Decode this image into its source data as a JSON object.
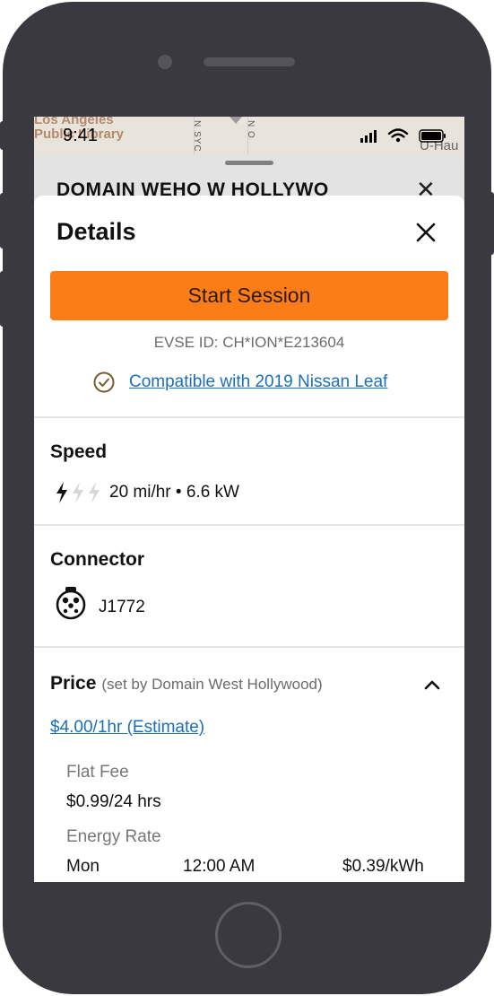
{
  "status_bar": {
    "time": "9:41"
  },
  "map": {
    "library_label": "Los Angeles\nPublic Library",
    "street_a": "N SYC",
    "street_b": "N O",
    "right_label": "U-Hau"
  },
  "back_sheet": {
    "title": "DOMAIN WEHO W HOLLYWO"
  },
  "details": {
    "title": "Details",
    "start_button": "Start Session",
    "evse_id": "EVSE ID: CH*ION*E213604",
    "compatible_link": "Compatible with 2019 Nissan Leaf",
    "speed": {
      "heading": "Speed",
      "value": "20 mi/hr • 6.6 kW",
      "level": "1 of 3 bolts"
    },
    "connector": {
      "heading": "Connector",
      "type": "J1772"
    },
    "price": {
      "heading": "Price",
      "set_by": "(set by Domain West Hollywood)",
      "estimate": "$4.00/1hr (Estimate)",
      "flat_fee_label": "Flat Fee",
      "flat_fee_value": "$0.99/24 hrs",
      "energy_rate_label": "Energy Rate",
      "rate_day": "Mon",
      "rate_time": "12:00 AM",
      "rate_value": "$0.39/kWh"
    }
  },
  "colors": {
    "accent": "#fb7d17",
    "link": "#1b6fb8",
    "phone_body": "#3a3940",
    "check": "#7a5a2e"
  }
}
